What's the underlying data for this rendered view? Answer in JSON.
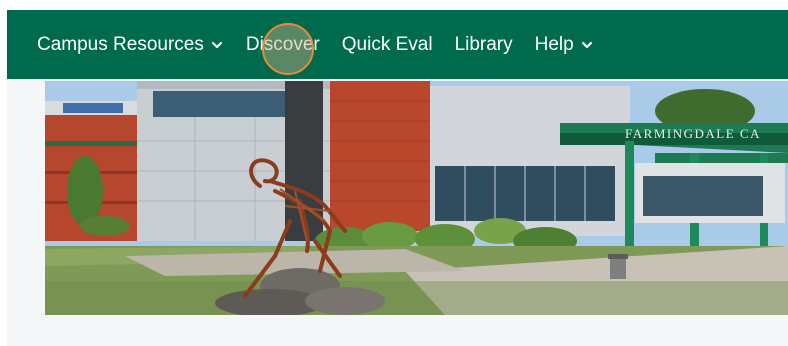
{
  "nav": {
    "items": [
      {
        "label": "Campus Resources",
        "has_dropdown": true
      },
      {
        "label": "Discover",
        "has_dropdown": false
      },
      {
        "label": "Quick Eval",
        "has_dropdown": false
      },
      {
        "label": "Library",
        "has_dropdown": false
      },
      {
        "label": "Help",
        "has_dropdown": true
      }
    ]
  },
  "banner": {
    "sign_text": "FARMINGDALE CA"
  },
  "colors": {
    "nav_background": "#006a4d",
    "nav_text": "#ffffff",
    "page_background": "#f5f6f8",
    "highlight_ring": "#e88a3a"
  },
  "icons": {
    "dropdown": "chevron-down-icon"
  }
}
